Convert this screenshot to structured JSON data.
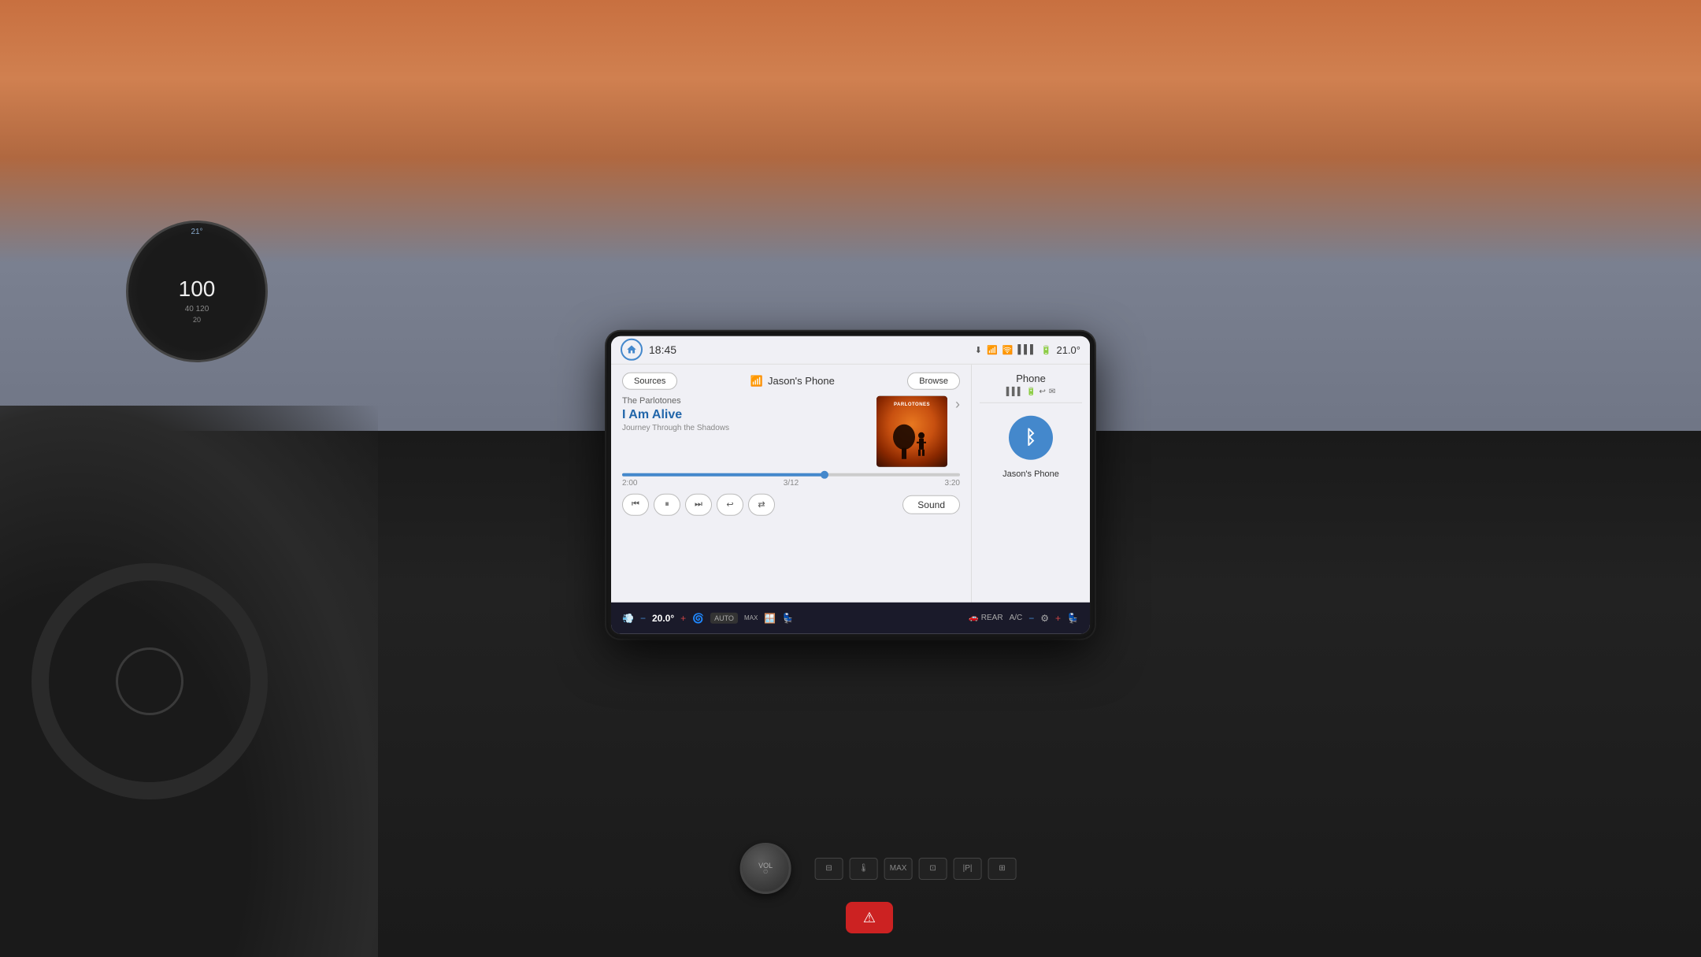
{
  "background": {
    "desc": "Car interior with city skyline"
  },
  "status_bar": {
    "time": "18:45",
    "temperature": "21.0°",
    "home_label": "Home",
    "signal_bars": "▌▌▌",
    "battery_icon": "🔋",
    "wifi_icon": "📶"
  },
  "music": {
    "source": "Jason's Phone",
    "sources_label": "Sources",
    "browse_label": "Browse",
    "artist": "The Parlotones",
    "title": "I Am Alive",
    "album": "Journey Through the Shadows",
    "time_start": "2:00",
    "time_current": "3/12",
    "time_end": "3:20",
    "progress_percent": 60,
    "sound_label": "Sound"
  },
  "controls": {
    "prev_label": "⏮",
    "play_pause_label": "⏸",
    "next_label": "⏭",
    "repeat_label": "🔁",
    "shuffle_label": "🔀"
  },
  "phone_panel": {
    "title": "Phone",
    "device_name": "Jason's Phone",
    "signal": "▌▌▌",
    "battery": "🔋"
  },
  "climate": {
    "temp_left": "20.0°",
    "minus_left": "−",
    "plus_left": "+",
    "auto_label": "AUTO",
    "max_label": "MAX",
    "rear_label": "REAR",
    "ac_label": "A/C",
    "temp_right": "",
    "minus_right": "−",
    "plus_right": "+"
  },
  "physical_controls": {
    "vol_label": "VOL",
    "vol_power": "⏻",
    "buttons": [
      "⊟",
      "🌡",
      "MAX",
      "⊡",
      "|P|",
      "⊞"
    ]
  },
  "hazard": {
    "icon": "⚠"
  }
}
